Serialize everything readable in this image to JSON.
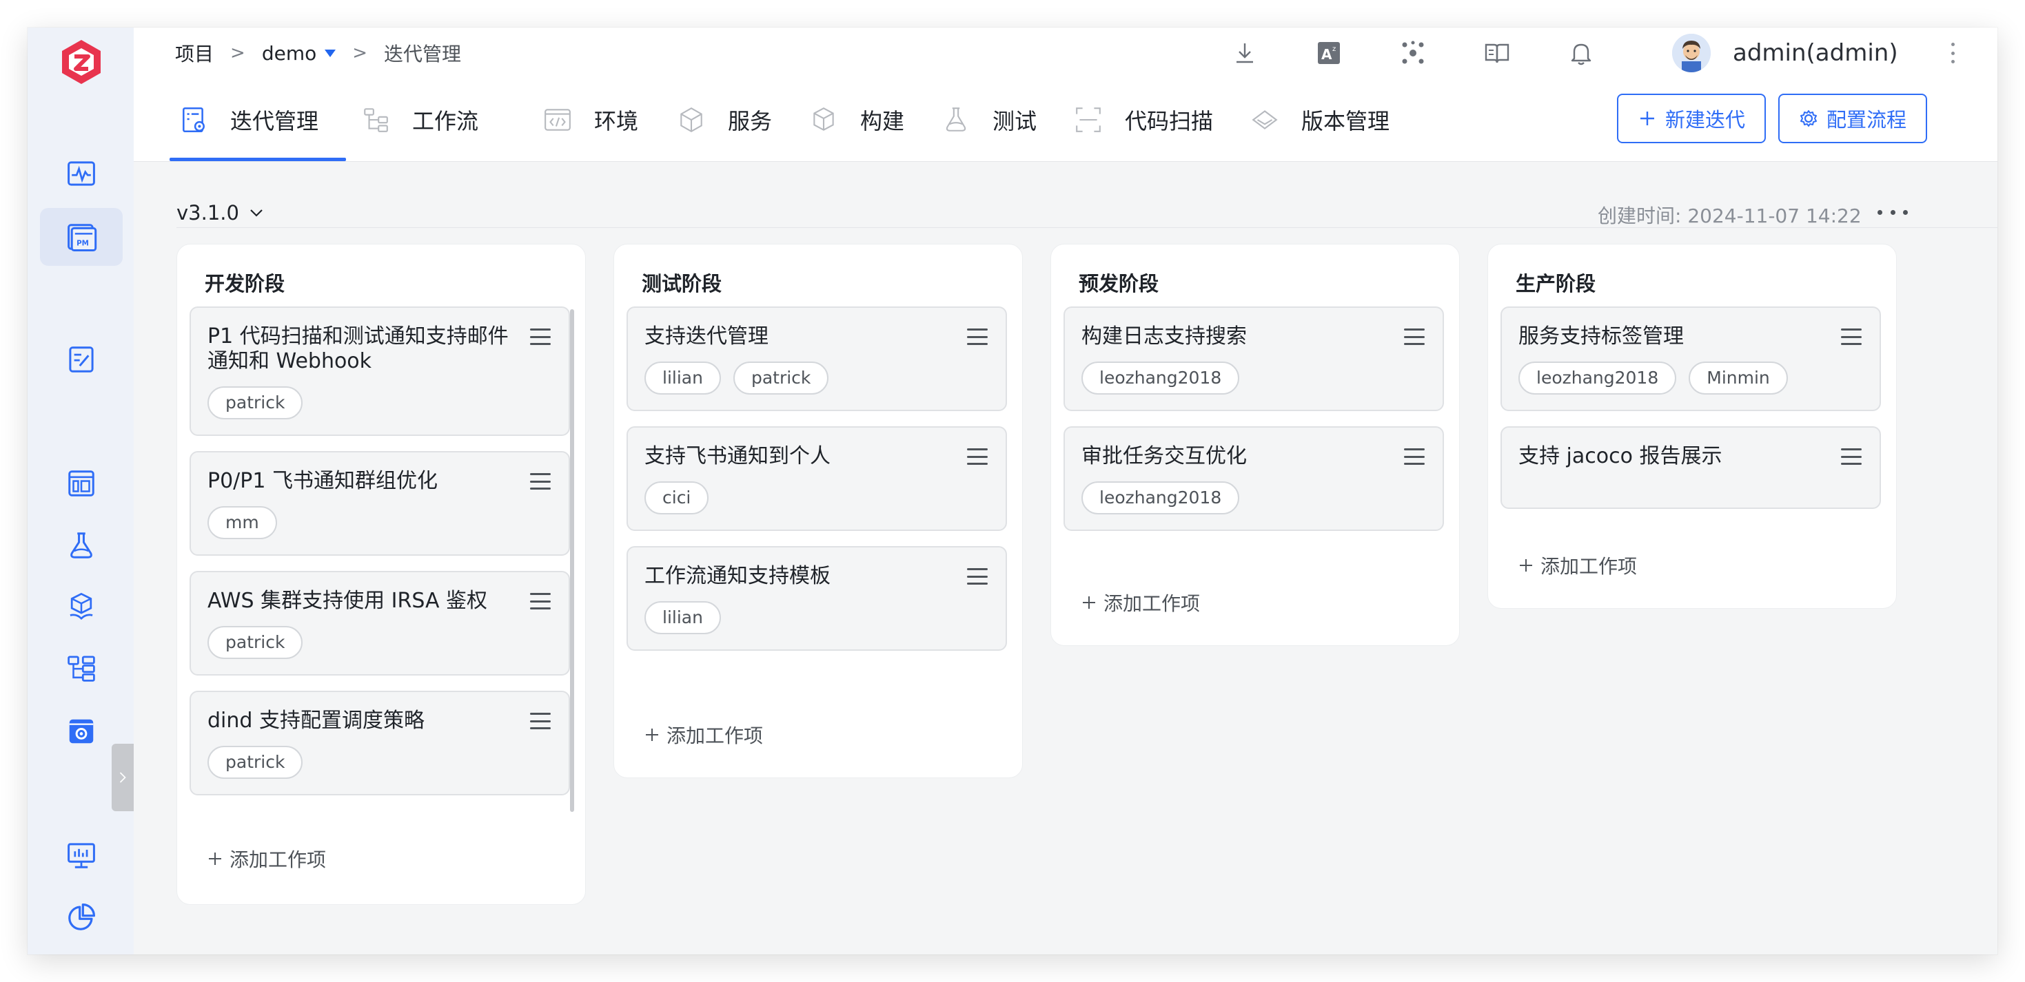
{
  "sidebar": {
    "logo": "zadig-logo-icon",
    "items": [
      {
        "icon": "pulse-icon"
      },
      {
        "icon": "pm-icon",
        "active": true
      },
      {
        "icon": "edit-doc-icon"
      },
      {
        "icon": "dashboard-icon"
      },
      {
        "icon": "flask-icon"
      },
      {
        "icon": "cube-hand-icon"
      },
      {
        "icon": "tree-icon"
      },
      {
        "icon": "settings-box-icon"
      },
      {
        "icon": "monitor-chart-icon"
      },
      {
        "icon": "pie-chart-icon"
      }
    ]
  },
  "breadcrumb": {
    "root": "项目",
    "sep1": ">",
    "project": "demo",
    "sep2": ">",
    "current": "迭代管理"
  },
  "topbar": {
    "icons": [
      "download-icon",
      "translate-icon",
      "network-icon",
      "book-icon",
      "bell-icon"
    ],
    "username": "admin(admin)"
  },
  "tabs": [
    {
      "label": "迭代管理",
      "icon": "iteration-icon",
      "active": true
    },
    {
      "label": "工作流",
      "icon": "workflow-icon"
    },
    {
      "label": "环境",
      "icon": "code-icon"
    },
    {
      "label": "服务",
      "icon": "service-icon"
    },
    {
      "label": "构建",
      "icon": "build-icon"
    },
    {
      "label": "测试",
      "icon": "flask-icon"
    },
    {
      "label": "代码扫描",
      "icon": "scan-icon"
    },
    {
      "label": "版本管理",
      "icon": "version-icon"
    }
  ],
  "actions": {
    "new_iteration": "新建迭代",
    "config_flow": "配置流程"
  },
  "version": {
    "label": "v3.1.0",
    "created": "创建时间: 2024-11-07 14:22"
  },
  "add_item_label": "添加工作项",
  "columns": [
    {
      "title": "开发阶段",
      "cards": [
        {
          "title": "P1 代码扫描和测试通知支持邮件通知和 Webhook",
          "tags": [
            "patrick"
          ]
        },
        {
          "title": "P0/P1 飞书通知群组优化",
          "tags": [
            "mm"
          ]
        },
        {
          "title": "AWS 集群支持使用 IRSA 鉴权",
          "tags": [
            "patrick"
          ]
        },
        {
          "title": "dind 支持配置调度策略",
          "tags": [
            "patrick"
          ]
        }
      ]
    },
    {
      "title": "测试阶段",
      "cards": [
        {
          "title": "支持迭代管理",
          "tags": [
            "lilian",
            "patrick"
          ]
        },
        {
          "title": "支持飞书通知到个人",
          "tags": [
            "cici"
          ]
        },
        {
          "title": "工作流通知支持模板",
          "tags": [
            "lilian"
          ]
        }
      ]
    },
    {
      "title": "预发阶段",
      "cards": [
        {
          "title": "构建日志支持搜索",
          "tags": [
            "leozhang2018"
          ]
        },
        {
          "title": "审批任务交互优化",
          "tags": [
            "leozhang2018"
          ]
        }
      ]
    },
    {
      "title": "生产阶段",
      "cards": [
        {
          "title": "服务支持标签管理",
          "tags": [
            "leozhang2018",
            "Minmin"
          ]
        },
        {
          "title": "支持 jacoco 报告展示",
          "tags": []
        }
      ]
    }
  ],
  "colors": {
    "accent": "#2f6df6",
    "logo": "#e8344e",
    "sidebar_icon": "#2f6df6"
  }
}
